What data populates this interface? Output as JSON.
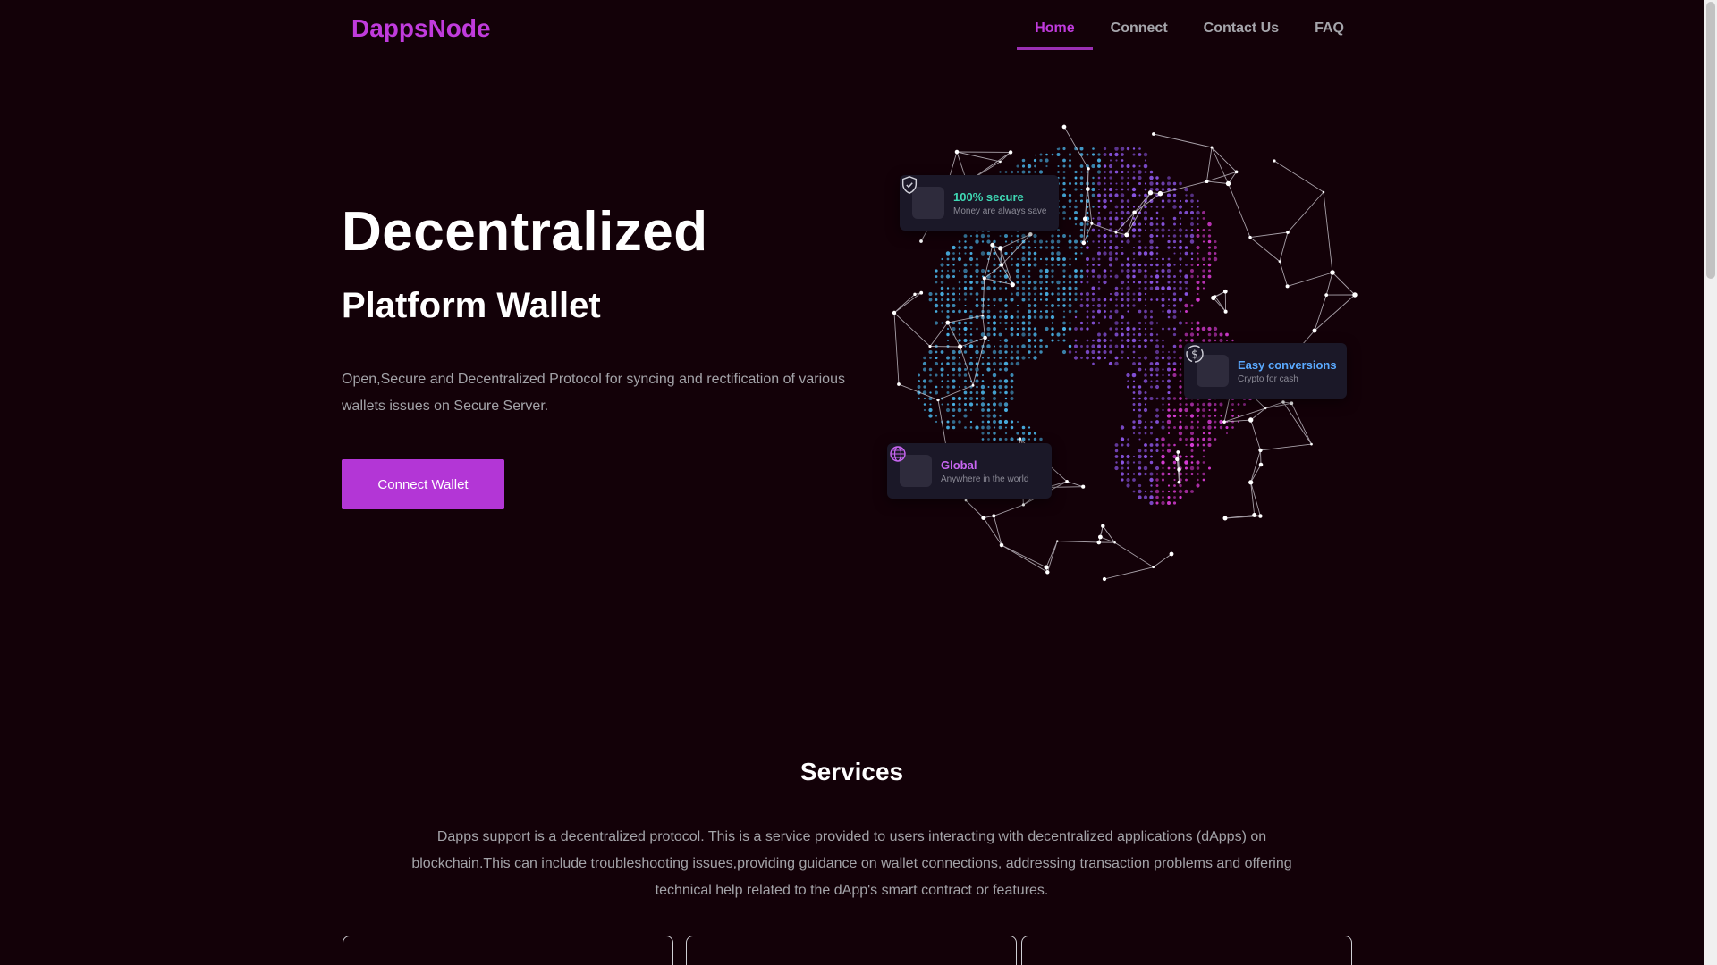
{
  "brand": {
    "name": "DappsNode",
    "accent": "#c03bdc",
    "button": "#b336d6"
  },
  "nav": {
    "items": [
      {
        "label": "Home",
        "active": true
      },
      {
        "label": "Connect",
        "active": false
      },
      {
        "label": "Contact Us",
        "active": false
      },
      {
        "label": "FAQ",
        "active": false
      }
    ]
  },
  "hero": {
    "title": "Decentralized",
    "subtitle": "Platform Wallet",
    "description": "Open,Secure and Decentralized Protocol for syncing and rectification of various wallets issues on Secure Server.",
    "cta": "Connect Wallet"
  },
  "globe_cards": {
    "secure": {
      "title": "100% secure",
      "subtitle": "Money are always save",
      "title_color": "#3fd8b4",
      "icon": "shield-icon"
    },
    "conversions": {
      "title": "Easy conversions",
      "subtitle": "Crypto for cash",
      "title_color": "#5aa9ff",
      "icon": "dollar-exchange-icon"
    },
    "global": {
      "title": "Global",
      "subtitle": "Anywhere in the world",
      "title_color": "#c866f2",
      "icon": "globe-icon"
    }
  },
  "services": {
    "title": "Services",
    "description": "Dapps support is a decentralized protocol. This is a service provided to users interacting with decentralized applications (dApps) on blockchain.This can include troubleshooting issues,providing guidance on wallet connections, addressing transaction problems and offering technical help related to the dApp's smart contract or features."
  }
}
